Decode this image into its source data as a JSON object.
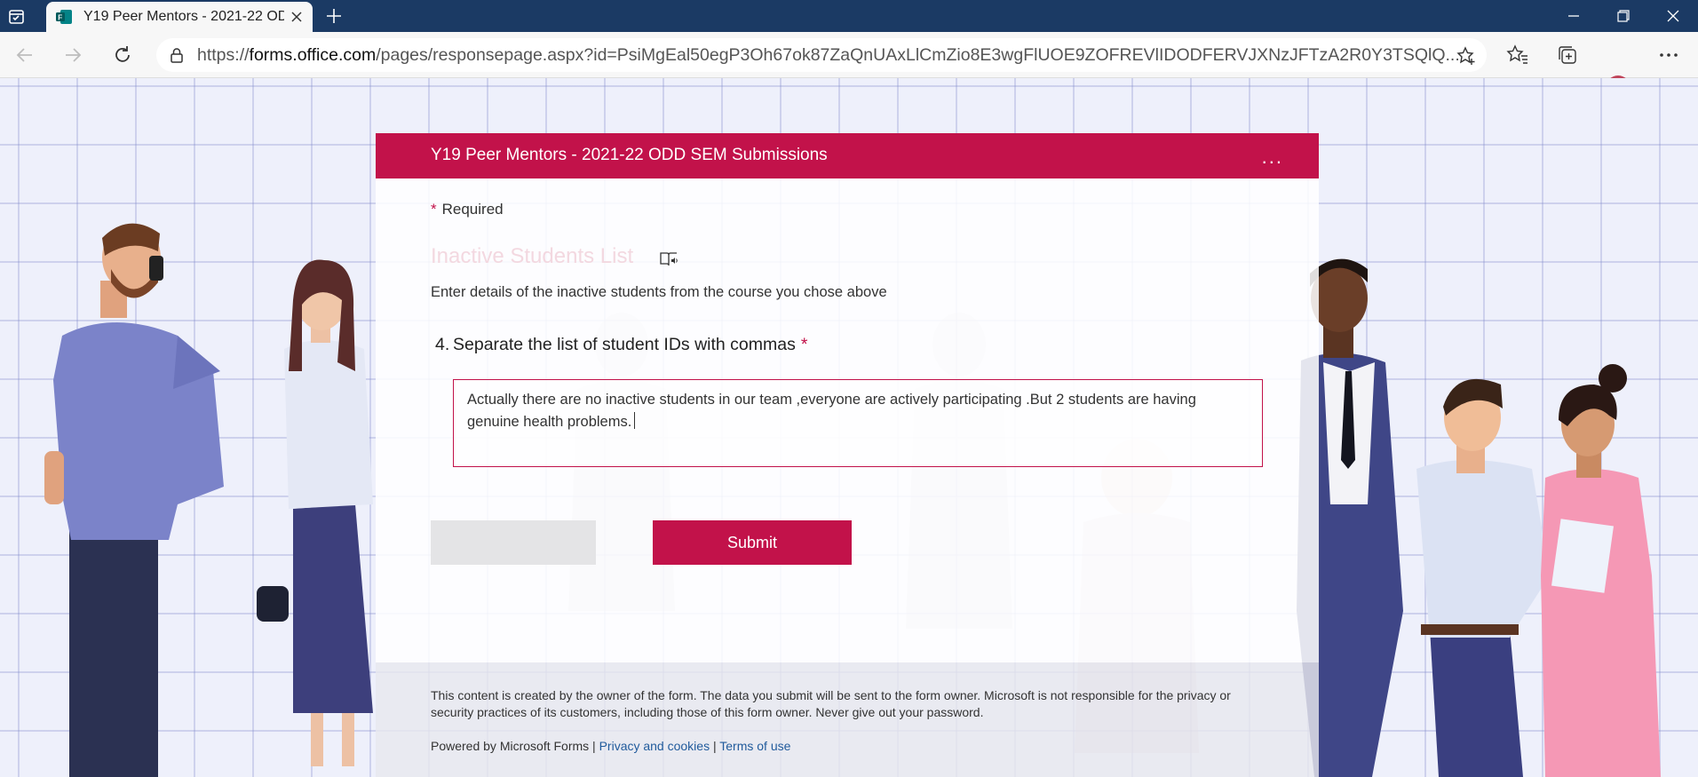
{
  "browser": {
    "tab_title": "Y19 Peer Mentors - 2021-22 ODD SEM Submissions",
    "url_prefix": "https://",
    "url_host": "forms.office.com",
    "url_path": "/pages/responsepage.aspx?id=PsiMgEal50egP3Oh67ok87ZaQnUAxLlCmZio8E3wgFlUOE9ZOFREVlIDODFERVJXNzJFTzA2R0Y3TSQlQ..."
  },
  "form": {
    "header_title": "Y19 Peer Mentors - 2021-22 ODD SEM Submissions",
    "more_label": "...",
    "required_star": "*",
    "required_label": "Required",
    "section_title": "Inactive Students List",
    "section_description": "Enter details of the inactive students from the course you chose above",
    "question_number": "4.",
    "question_text": "Separate the list of student IDs with commas",
    "question_required_star": "*",
    "answer_value": "Actually there are no inactive students in our team ,everyone are actively participating .But 2 students are having genuine health problems.",
    "submit_label": "Submit"
  },
  "footer": {
    "disclaimer": "This content is created by the owner of the form. The data you submit will be sent to the form owner. Microsoft is not responsible for the privacy or security practices of its customers, including those of this form owner. Never give out your password.",
    "powered_by": "Powered by Microsoft Forms |",
    "privacy_link": "Privacy and cookies",
    "separator": "|",
    "terms_link": "Terms of use"
  },
  "colors": {
    "accent": "#c2124a",
    "titlebar": "#1b3a64",
    "link": "#215b9c"
  }
}
